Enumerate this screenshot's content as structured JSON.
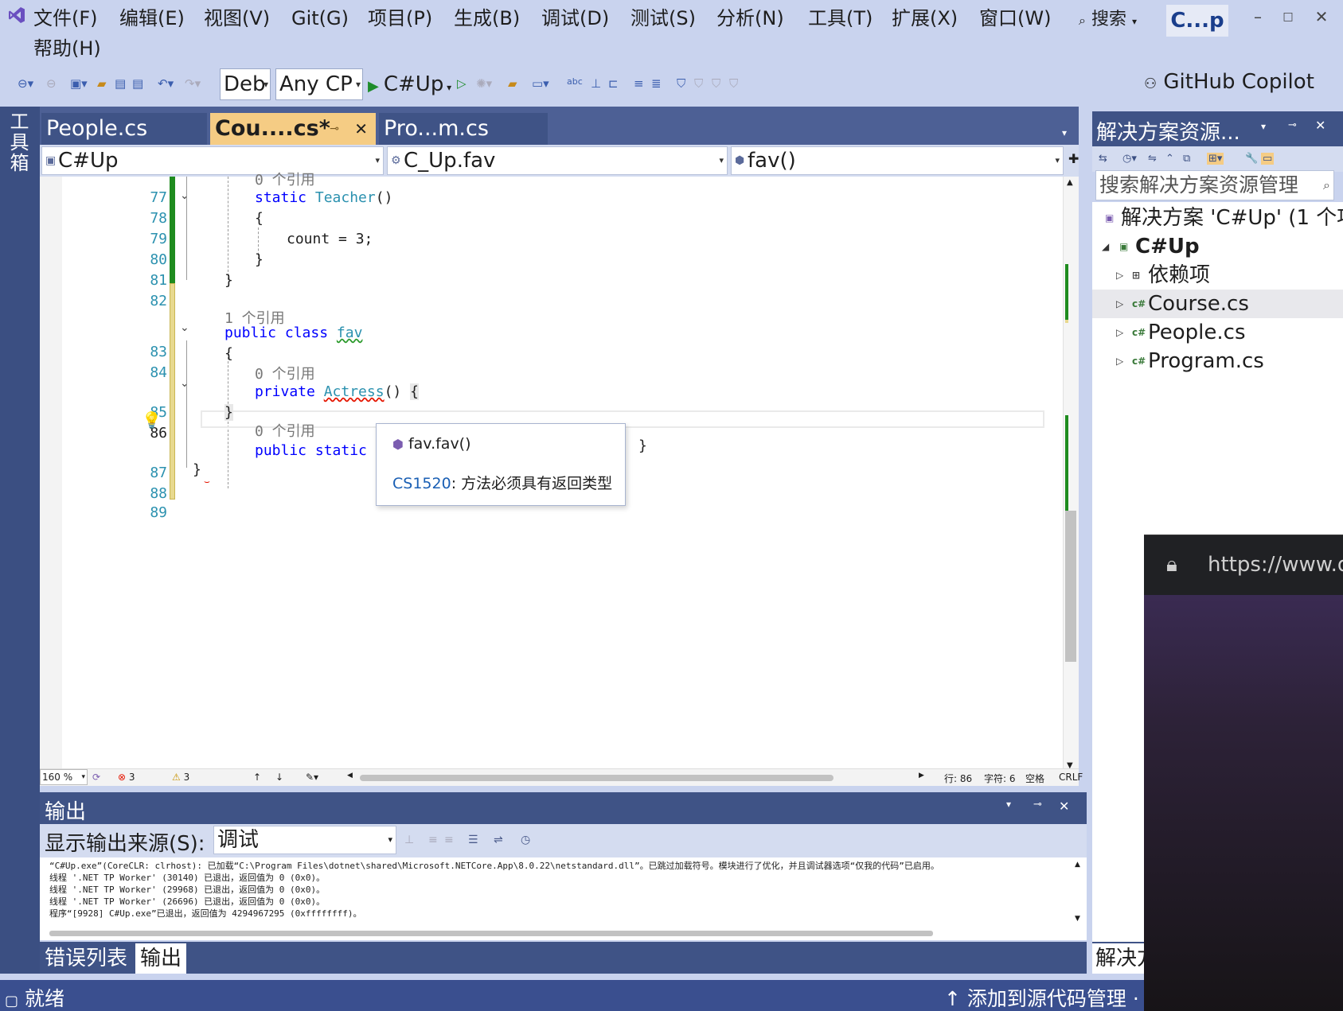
{
  "menu": {
    "items": [
      "文件(F)",
      "编辑(E)",
      "视图(V)",
      "Git(G)",
      "项目(P)",
      "生成(B)",
      "调试(D)",
      "测试(S)",
      "分析(N)",
      "工具(T)",
      "扩展(X)",
      "窗口(W)",
      "帮助(H)"
    ],
    "search_label": "搜索",
    "title_badge": "C...p"
  },
  "toolbar": {
    "config": "Deb",
    "platform": "Any CP",
    "run_target": "C#Up",
    "copilot": "GitHub Copilot"
  },
  "toolbox": {
    "label": "工具箱"
  },
  "tabs": [
    {
      "label": "People.cs"
    },
    {
      "label": "Cou....cs*"
    },
    {
      "label": "Pro...m.cs"
    }
  ],
  "navbar": {
    "project": "C#Up",
    "type": "C_Up.fav",
    "member": "fav()"
  },
  "code": {
    "line_numbers": [
      "77",
      "78",
      "79",
      "80",
      "81",
      "82",
      "83",
      "84",
      "85",
      "86",
      "87",
      "88",
      "89"
    ],
    "lens_0": "0 个引用",
    "lens_1": "1 个引用",
    "lens_2": "0 个引用",
    "lens_3": "0 个引用",
    "kw_static": "static",
    "ty_teacher": "Teacher",
    "paren": "()",
    "open_brace": "{",
    "close_brace": "}",
    "count_stmt": "count = 3;",
    "kw_public": "public",
    "kw_class": "class",
    "class_name": "fav",
    "kw_private": "private",
    "method_actress": "Actress",
    "kw_public2": "public",
    "kw_static2": "static"
  },
  "tooltip": {
    "signature": "fav.fav()",
    "error_code": "CS1520",
    "error_message": ": 方法必须具有返回类型"
  },
  "editor_status": {
    "zoom": "160 %",
    "errors": "3",
    "warnings": "3",
    "line": "行: 86",
    "char": "字符: 6",
    "whitespace": "空格",
    "eol": "CRLF"
  },
  "output": {
    "title": "输出",
    "source_label": "显示输出来源(S):",
    "source_value": "调试",
    "lines": [
      "“C#Up.exe”(CoreCLR: clrhost): 已加载“C:\\Program Files\\dotnet\\shared\\Microsoft.NETCore.App\\8.0.22\\netstandard.dll”。已跳过加载符号。模块进行了优化，并且调试器选项“仅我的代码”已启用。",
      "线程 '.NET TP Worker' (30140) 已退出，返回值为 0 (0x0)。",
      "线程 '.NET TP Worker' (29968) 已退出，返回值为 0 (0x0)。",
      "线程 '.NET TP Worker' (26696) 已退出，返回值为 0 (0x0)。",
      "程序“[9928] C#Up.exe”已退出，返回值为 4294967295 (0xffffffff)。"
    ]
  },
  "bottom_tabs": {
    "errors": "错误列表",
    "output": "输出"
  },
  "statusbar": {
    "left": "就绪",
    "right": "↑ 添加到源代码管理 ·"
  },
  "solution_explorer": {
    "title": "解决方案资源...",
    "search_placeholder": "搜索解决方案资源管理",
    "solution": "解决方案 'C#Up' (1 个项",
    "project": "C#Up",
    "dependencies": "依赖项",
    "files": [
      "Course.cs",
      "People.cs",
      "Program.cs"
    ],
    "bottom_tab": "解决方"
  },
  "browser": {
    "url": "https://www.d"
  }
}
